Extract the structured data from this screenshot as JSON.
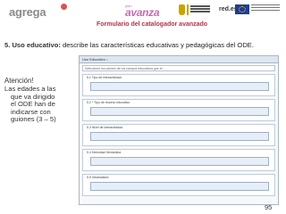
{
  "header": {
    "brand": "agrega",
    "avanza_small": "plan",
    "avanza_big": "avanza",
    "redes": "red.es",
    "title": "Formulario del catalogador avanzado"
  },
  "intro": {
    "lead": "5. Uso educativo:",
    "text": " describe las características educativas y pedagógicas del ODE."
  },
  "note": {
    "title": "Atención!",
    "line1": "Las edades a las",
    "line2": "que va dirigido",
    "line3": "el ODE han de",
    "line4": "indicarse con",
    "line5": "guiones (3 – 5)"
  },
  "form": {
    "header": "Uso Educativo ↓",
    "search_placeholder": "Seleccione los valores  de los campos  educativos que el ...",
    "fields": [
      {
        "label": "5.1 Tipo de interactividad"
      },
      {
        "label": "5.2 * Tipo de recurso educativo"
      },
      {
        "label": "5.3 Nivel de interactividad"
      },
      {
        "label": "5.4 Densidad Semántica"
      },
      {
        "label": "5.5 Destinatario"
      }
    ]
  },
  "page_number": "95",
  "colors": {
    "title": "#b4324a",
    "panel_border": "#aab6c4",
    "avanza": "#c86ab2"
  }
}
